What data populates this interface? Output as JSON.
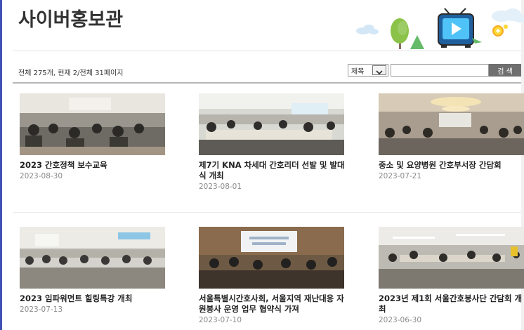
{
  "page": {
    "title": "사이버홍보관"
  },
  "summary": "전체 275개, 현재 2/전체 31페이지",
  "search": {
    "field_selected": "제목",
    "input_value": "",
    "button_label": "검 색"
  },
  "posts": [
    {
      "title": "2023 간호정책 보수교육",
      "date": "2023-08-30"
    },
    {
      "title": "제7기 KNA 차세대 간호리더 선발 및 발대식 개최",
      "date": "2023-08-01"
    },
    {
      "title": "중소 및 요양병원 간호부서장 간담회",
      "date": "2023-07-21"
    },
    {
      "title": "2023 임파워먼트 힐링특강 개최",
      "date": "2023-07-13"
    },
    {
      "title": "서울특별시간호사회, 서울지역 재난대응 자원봉사 운영 업무 협약식 가져",
      "date": "2023-07-10"
    },
    {
      "title": "2023년 제1회 서울간호봉사단 간담회 개최",
      "date": "2023-06-30"
    }
  ]
}
